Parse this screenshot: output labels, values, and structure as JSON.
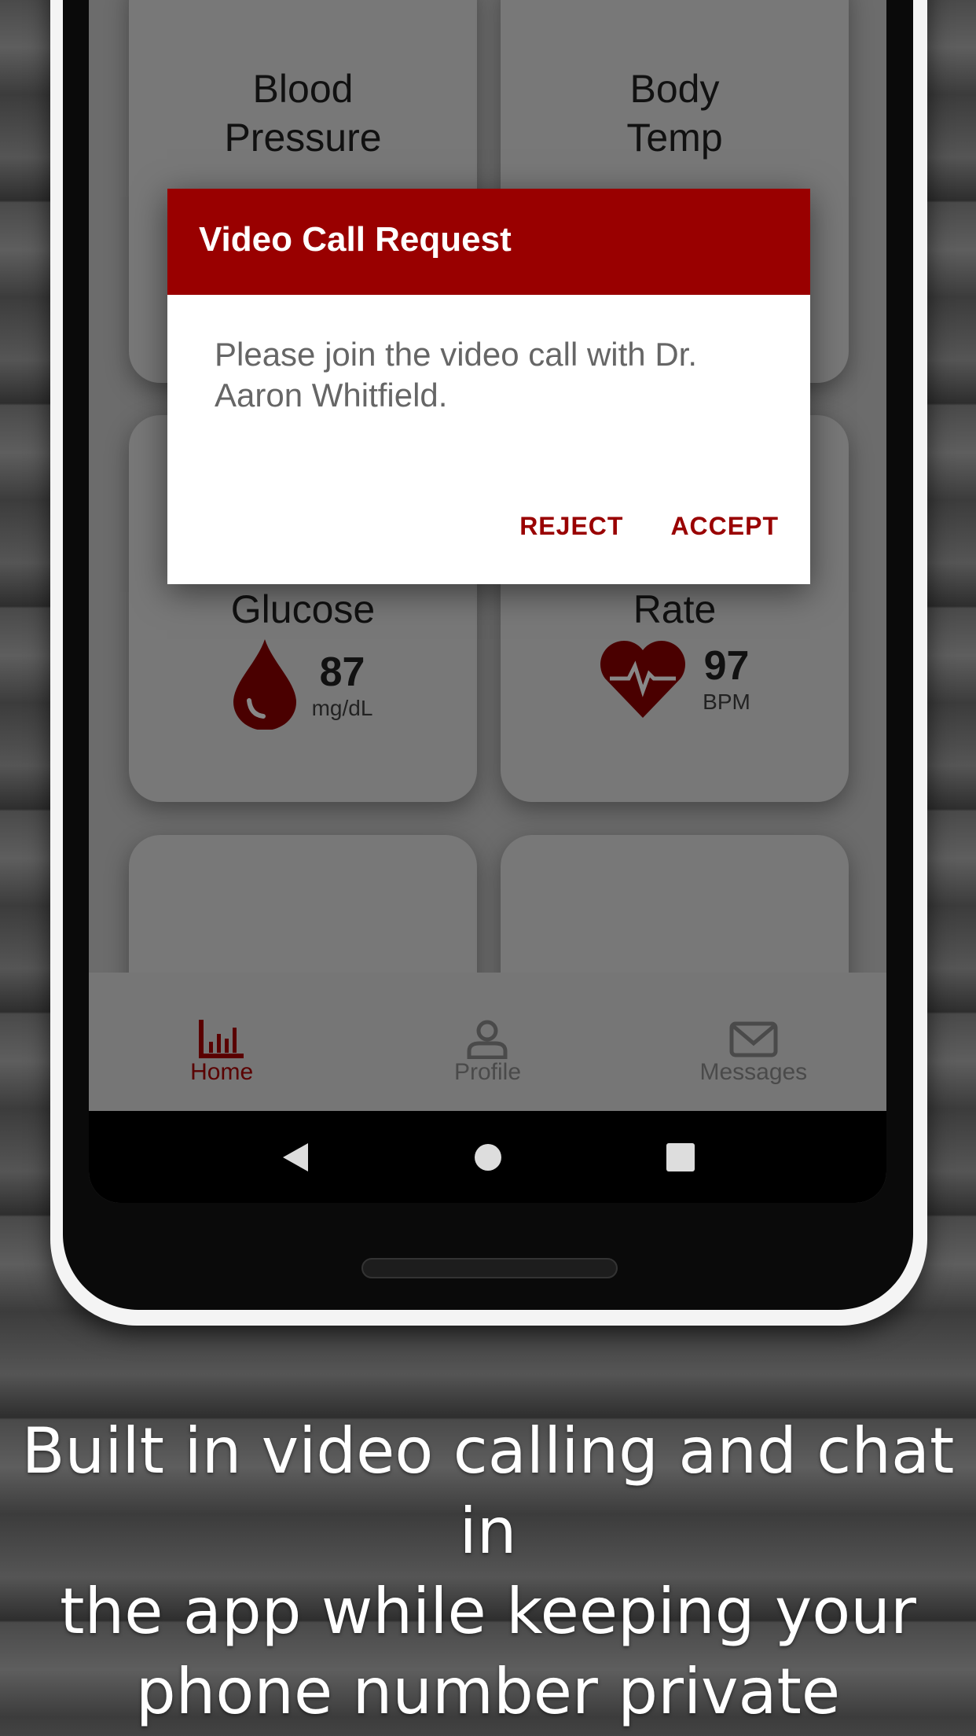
{
  "cards": [
    {
      "title_line1": "Blood",
      "title_line2": "Pressure"
    },
    {
      "title_line1": "Body",
      "title_line2": "Temp"
    },
    {
      "title_line1": "",
      "title_line2": "Glucose",
      "value": "87",
      "unit": "mg/dL",
      "icon": "blood-drop-icon"
    },
    {
      "title_line1": "",
      "title_line2": "Rate",
      "value": "97",
      "unit": "BPM",
      "icon": "heart-pulse-icon"
    }
  ],
  "bottom_nav": [
    {
      "label": "Home",
      "icon": "bar-chart-icon",
      "active": true
    },
    {
      "label": "Profile",
      "icon": "person-icon"
    },
    {
      "label": "Messages",
      "icon": "envelope-icon"
    }
  ],
  "dialog": {
    "title": "Video Call Request",
    "message": "Please join the video call with Dr. Aaron Whitfield.",
    "reject": "REJECT",
    "accept": "ACCEPT"
  },
  "colors": {
    "accent": "#990000"
  },
  "caption": {
    "line1": "Built in video calling and chat in",
    "line2": "the app while keeping your",
    "line3": "phone number private"
  }
}
